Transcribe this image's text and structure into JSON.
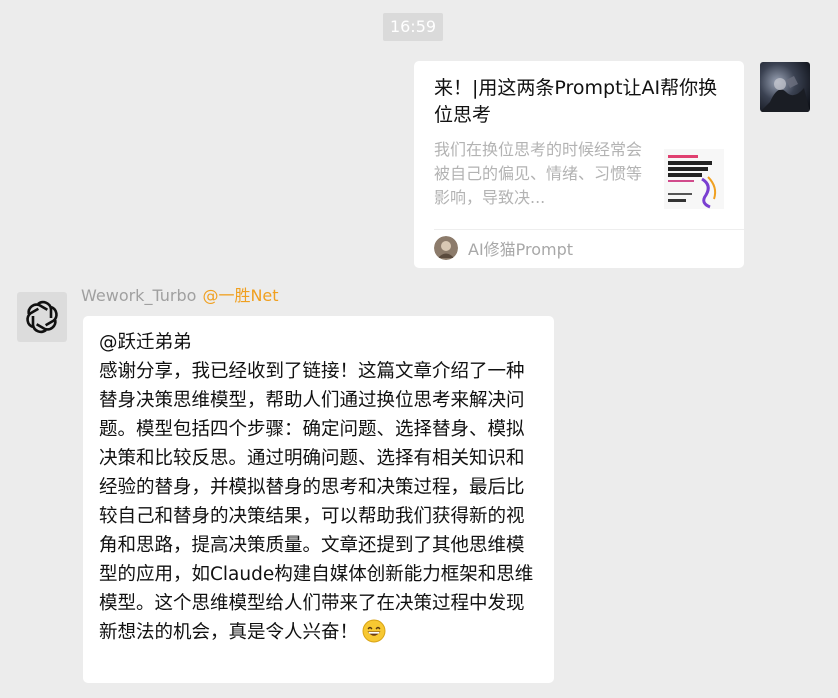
{
  "timestamp": "16:59",
  "shared_card": {
    "title": "来！|用这两条Prompt让AI帮你换位思考",
    "description": "我们在换位思考的时候经常会被自己的偏见、情绪、习惯等影响，导致决...",
    "source_name": "AI修猫Prompt",
    "thumbnail_icon": "article-cover-thumbnail"
  },
  "bot_message": {
    "sender_name": "Wework_Turbo",
    "sender_org": "@一胜Net",
    "mention": "@跃迁弟弟",
    "text": "感谢分享，我已经收到了链接！这篇文章介绍了一种替身决策思维模型，帮助人们通过换位思考来解决问题。模型包括四个步骤：确定问题、选择替身、模拟决策和比较反思。通过明确问题、选择有相关知识和经验的替身，并模拟替身的思考和决策过程，最后比较自己和替身的决策结果，可以帮助我们获得新的视角和思路，提高决策质量。文章还提到了其他思维模型的应用，如Claude构建自媒体创新能力框架和思维模型。这个思维模型给人们带来了在决策过程中发现新想法的机会，真是令人兴奋！",
    "emoji_icon": "grinning-face-emoji"
  },
  "colors": {
    "background": "#ececec",
    "bubble": "#ffffff",
    "org_accent": "#f0a020",
    "muted_text": "#a0a0a0"
  }
}
